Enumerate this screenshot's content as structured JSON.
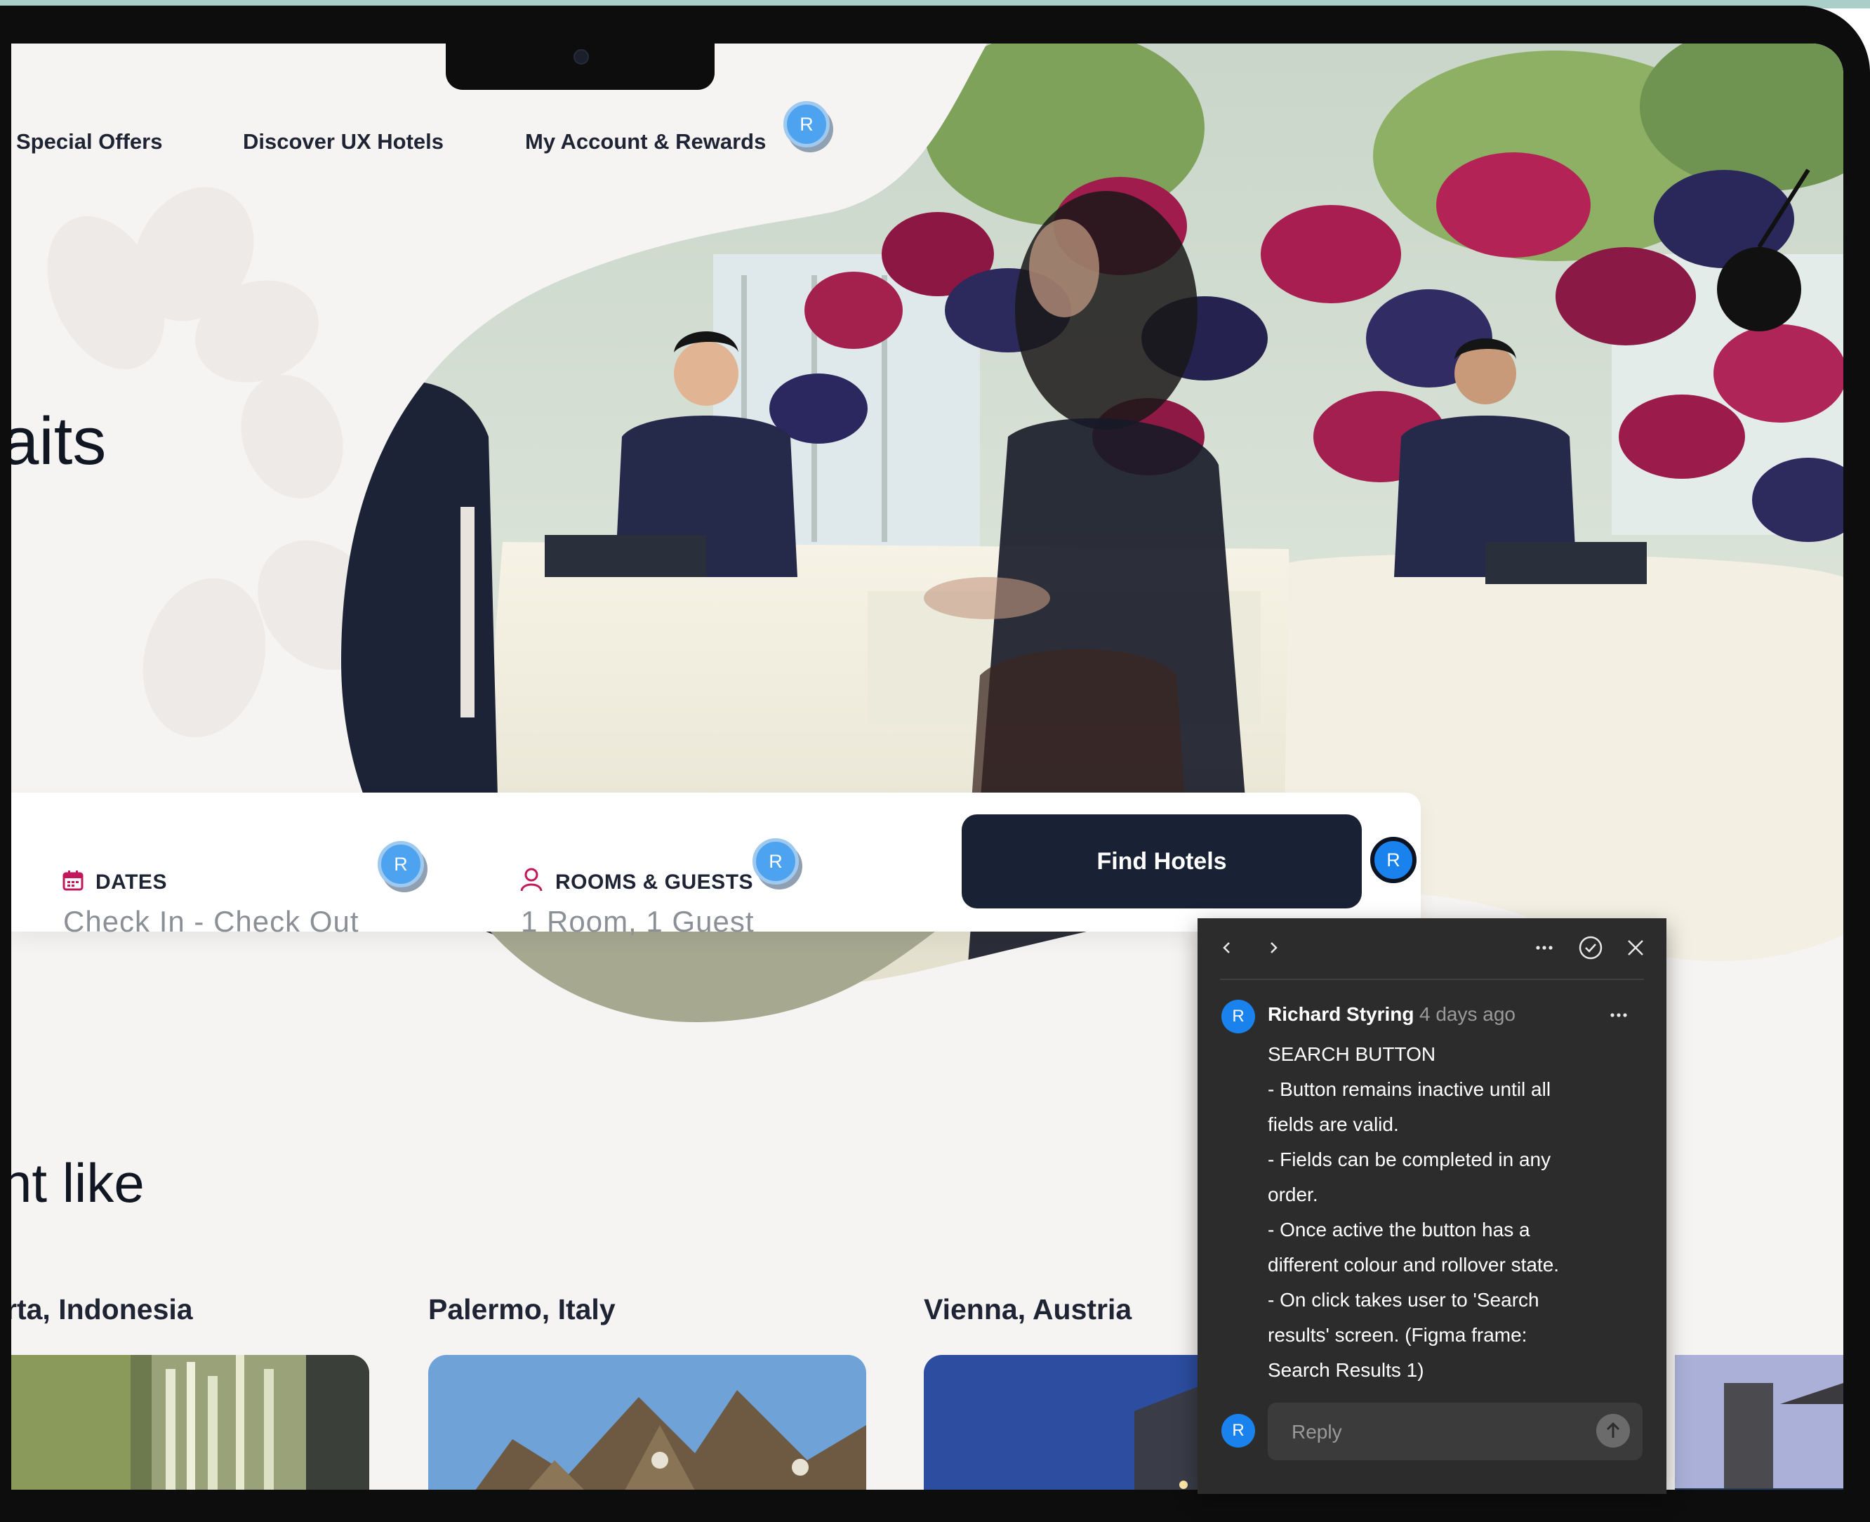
{
  "nav": {
    "items": [
      {
        "label": "Special Offers"
      },
      {
        "label": "Discover UX Hotels"
      },
      {
        "label": "My Account & Rewards"
      }
    ]
  },
  "hero": {
    "headline_fragment": "aits",
    "section_heading_fragment": "ht like"
  },
  "comment_markers": {
    "initial": "R"
  },
  "search": {
    "dates_label": "DATES",
    "dates_value": "Check In - Check Out",
    "rooms_label": "ROOMS & GUESTS",
    "rooms_value": "1 Room, 1 Guest",
    "button_label": "Find Hotels"
  },
  "destinations": [
    {
      "city": "rta, Indonesia"
    },
    {
      "city": "Palermo, Italy"
    },
    {
      "city": "Vienna, Austria"
    }
  ],
  "comment": {
    "author_initial": "R",
    "author": "Richard Styring",
    "time": "4 days ago",
    "lines": [
      "SEARCH BUTTON",
      "- Button remains inactive until all",
      "fields are valid.",
      "- Fields can be completed in any",
      "order.",
      "- Once active the button has a",
      "different colour and rollover state.",
      "- On click takes user to 'Search",
      "results' screen. (Figma frame:",
      "Search Results 1)"
    ],
    "reply_placeholder": "Reply"
  },
  "colors": {
    "brand_dark": "#182234",
    "accent_pink": "#c2185b",
    "marker_blue": "#4ea3f0",
    "panel_bg": "#2c2c2c"
  },
  "icons": [
    "calendar-icon",
    "person-icon",
    "chevron-left-icon",
    "chevron-right-icon",
    "more-icon",
    "resolve-check-icon",
    "close-icon",
    "send-arrow-icon"
  ]
}
